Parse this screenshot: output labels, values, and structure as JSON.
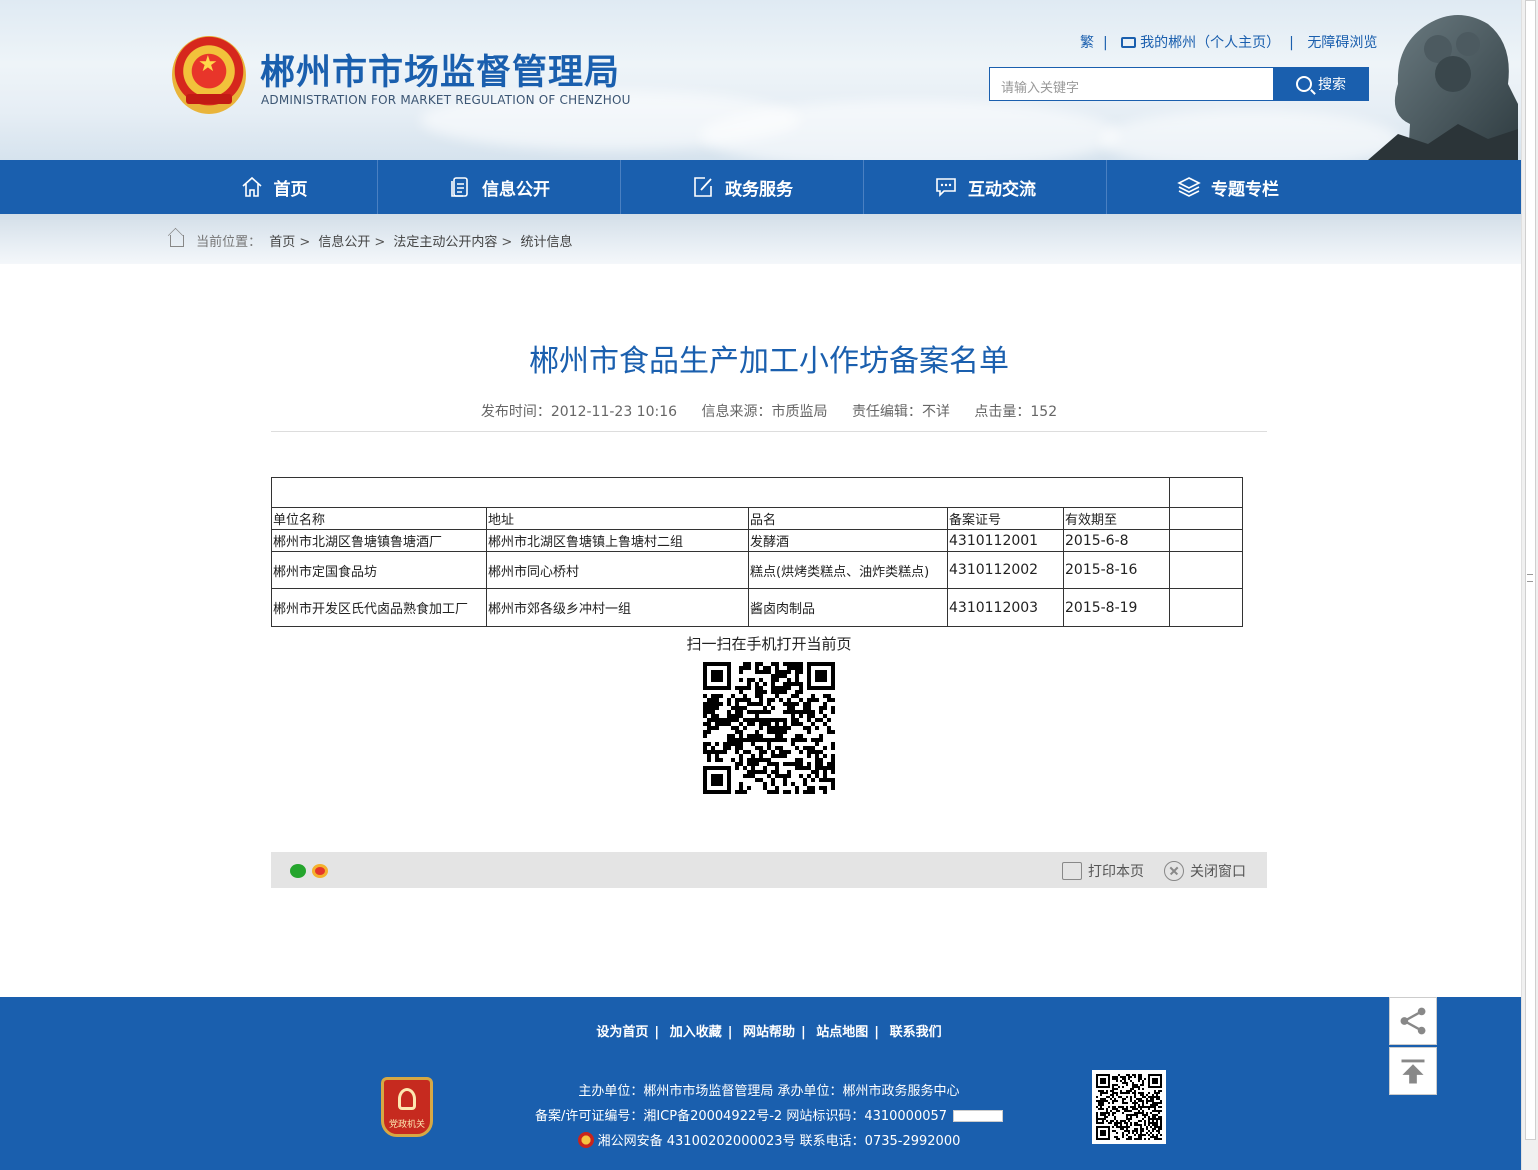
{
  "header": {
    "title": "郴州市市场监督管理局",
    "subtitle": "ADMINISTRATION FOR MARKET REGULATION OF CHENZHOU",
    "links": {
      "traditional": "繁",
      "my_chenzhou": "我的郴州（个人主页）",
      "accessibility": "无障碍浏览"
    },
    "search": {
      "placeholder": "请输入关键字",
      "button": "搜索"
    }
  },
  "nav": {
    "items": [
      {
        "label": "首页",
        "icon": "home-icon"
      },
      {
        "label": "信息公开",
        "icon": "document-icon"
      },
      {
        "label": "政务服务",
        "icon": "edit-icon"
      },
      {
        "label": "互动交流",
        "icon": "chat-icon"
      },
      {
        "label": "专题专栏",
        "icon": "layers-icon"
      }
    ]
  },
  "breadcrumb": {
    "prefix": "当前位置：",
    "items": [
      "首页",
      "信息公开",
      "法定主动公开内容",
      "统计信息"
    ]
  },
  "article": {
    "title": "郴州市食品生产加工小作坊备案名单",
    "publish_time_label": "发布时间：",
    "publish_time": "2012-11-23 10:16",
    "source_label": "信息来源：",
    "source": "市质监局",
    "editor_label": "责任编辑：",
    "editor": "不详",
    "hits_label": "点击量：",
    "hits": "152",
    "table": {
      "headers": [
        "单位名称",
        "地址",
        "品名",
        "备案证号",
        "有效期至",
        ""
      ],
      "rows": [
        [
          "郴州市北湖区鲁塘镇鲁塘酒厂",
          "郴州市北湖区鲁塘镇上鲁塘村二组",
          "发酵酒",
          "4310112001",
          "2015-6-8",
          ""
        ],
        [
          "郴州市定国食品坊",
          "郴州市同心桥村",
          "糕点(烘烤类糕点、油炸类糕点)",
          "4310112002",
          "2015-8-16",
          ""
        ],
        [
          "郴州市开发区氏代卤品熟食加工厂",
          "郴州市郊各级乡冲村一组",
          "酱卤肉制品",
          "4310112003",
          "2015-8-19",
          ""
        ]
      ]
    },
    "qr_label": "扫一扫在手机打开当前页"
  },
  "share_bar": {
    "print": "打印本页",
    "close": "关闭窗口"
  },
  "footer": {
    "links": [
      "设为首页",
      "加入收藏",
      "网站帮助",
      "站点地图",
      "联系我们"
    ],
    "line1": "主办单位：郴州市市场监督管理局   承办单位：郴州市政务服务中心",
    "line2": "备案/许可证编号：湘ICP备20004922号-2   网站标识码：4310000057",
    "line3": "湘公网安备 43100202000023号   联系电话：0735-2992000",
    "badge_text": "党政机关"
  },
  "colors": {
    "brand_blue": "#1a5fae",
    "nav_divider": "#4a80c2",
    "share_bar_bg": "#e4e4e4"
  }
}
